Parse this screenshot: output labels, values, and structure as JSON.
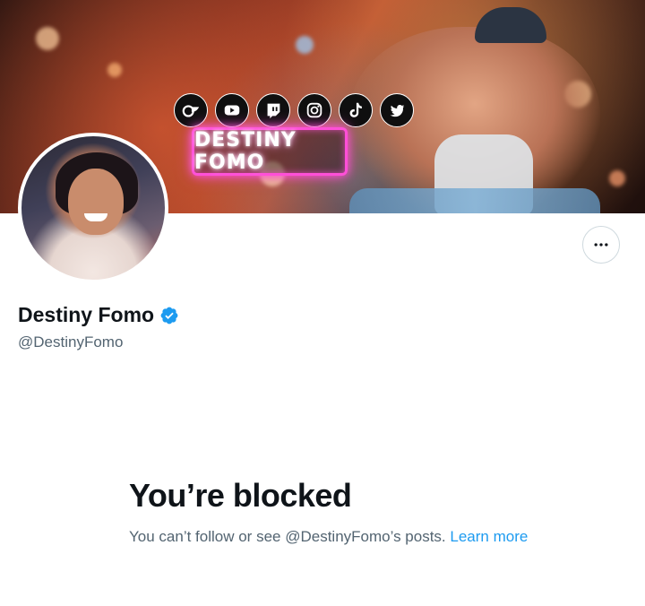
{
  "banner": {
    "social_icons": [
      "onlyfans-icon",
      "youtube-icon",
      "twitch-icon",
      "instagram-icon",
      "tiktok-icon",
      "twitter-icon"
    ],
    "neon_sign_text": "DESTINY FOMO"
  },
  "profile": {
    "display_name": "Destiny Fomo",
    "handle": "@DestinyFomo",
    "verified": true
  },
  "blocked": {
    "title": "You’re blocked",
    "message": "You can’t follow or see @DestinyFomo’s posts.",
    "learn_more": "Learn more"
  },
  "colors": {
    "accent": "#1d9bf0",
    "text_primary": "#0f1419",
    "text_secondary": "#536471",
    "border": "#cfd9de"
  }
}
